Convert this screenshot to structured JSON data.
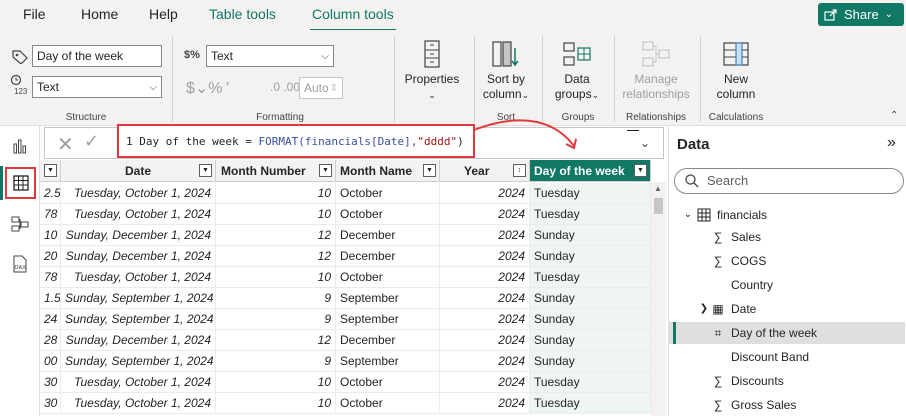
{
  "menu": {
    "items": [
      "File",
      "Home",
      "Help",
      "Table tools",
      "Column tools"
    ],
    "share_label": "Share"
  },
  "ribbon": {
    "structure": {
      "name_value": "Day of the week",
      "datatype_value": "Text",
      "label": "Structure"
    },
    "formatting": {
      "format_value": "Text",
      "auto_value": "Auto",
      "label": "Formatting"
    },
    "properties_label": "Properties",
    "sort": {
      "button_label_1": "Sort by",
      "button_label_2": "column",
      "label": "Sort"
    },
    "groups": {
      "button_label_1": "Data",
      "button_label_2": "groups",
      "label": "Groups"
    },
    "relationships": {
      "button_label_1": "Manage",
      "button_label_2": "relationships",
      "label": "Relationships"
    },
    "calculations": {
      "button_label_1": "New",
      "button_label_2": "column",
      "label": "Calculations"
    }
  },
  "formula": {
    "line_no": "1",
    "prefix": "Day of the week = ",
    "fn": "FORMAT(financials[Date],",
    "str": "\"dddd\"",
    "suffix": ")"
  },
  "table": {
    "columns": [
      "Date",
      "Month Number",
      "Month Name",
      "Year",
      "Day of the week"
    ],
    "rows": [
      [
        "2.5",
        "Tuesday, October 1, 2024",
        "10",
        "October",
        "2024",
        "Tuesday"
      ],
      [
        "78",
        "Tuesday, October 1, 2024",
        "10",
        "October",
        "2024",
        "Tuesday"
      ],
      [
        "10",
        "Sunday, December 1, 2024",
        "12",
        "December",
        "2024",
        "Sunday"
      ],
      [
        "20",
        "Sunday, December 1, 2024",
        "12",
        "December",
        "2024",
        "Sunday"
      ],
      [
        "78",
        "Tuesday, October 1, 2024",
        "10",
        "October",
        "2024",
        "Tuesday"
      ],
      [
        "1.5",
        "Sunday, September 1, 2024",
        "9",
        "September",
        "2024",
        "Sunday"
      ],
      [
        "24",
        "Sunday, September 1, 2024",
        "9",
        "September",
        "2024",
        "Sunday"
      ],
      [
        "28",
        "Sunday, December 1, 2024",
        "12",
        "December",
        "2024",
        "Sunday"
      ],
      [
        "00",
        "Sunday, September 1, 2024",
        "9",
        "September",
        "2024",
        "Sunday"
      ],
      [
        "30",
        "Tuesday, October 1, 2024",
        "10",
        "October",
        "2024",
        "Tuesday"
      ],
      [
        "30",
        "Tuesday, October 1, 2024",
        "10",
        "October",
        "2024",
        "Tuesday"
      ]
    ]
  },
  "pane": {
    "title": "Data",
    "search_placeholder": "Search",
    "table_name": "financials",
    "fields": [
      {
        "label": "Sales",
        "icon": "sigma-icon"
      },
      {
        "label": "COGS",
        "icon": "sigma-icon"
      },
      {
        "label": "Country",
        "icon": "none"
      },
      {
        "label": "Date",
        "icon": "calendar-icon"
      },
      {
        "label": "Day of the week",
        "icon": "calculated-column-icon"
      },
      {
        "label": "Discount Band",
        "icon": "none"
      },
      {
        "label": "Discounts",
        "icon": "sigma-icon"
      },
      {
        "label": "Gross Sales",
        "icon": "sigma-icon"
      }
    ]
  },
  "colors": {
    "accent": "#117865",
    "highlight": "#e03a3e"
  }
}
